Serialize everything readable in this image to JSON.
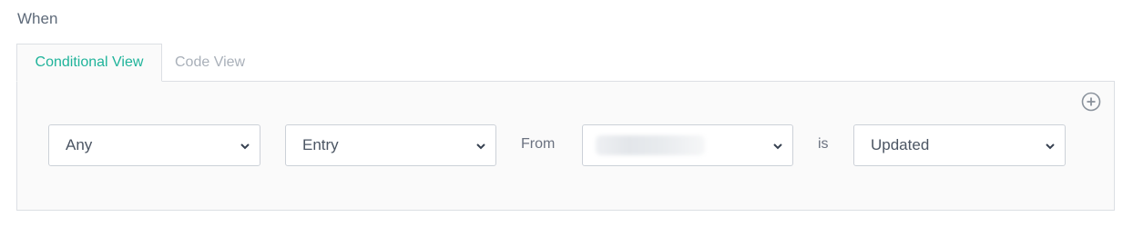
{
  "section": {
    "label": "When"
  },
  "tabs": [
    {
      "label": "Conditional View",
      "active": true
    },
    {
      "label": "Code View",
      "active": false
    }
  ],
  "condition": {
    "quantifier": {
      "value": "Any"
    },
    "entity": {
      "value": "Entry"
    },
    "from_label": "From",
    "source": {
      "value": "",
      "redacted": true
    },
    "is_label": "is",
    "event": {
      "value": "Updated"
    }
  },
  "icons": {
    "add": "plus-circle-icon",
    "dropdown": "chevron-down-icon"
  },
  "colors": {
    "accent": "#1fb39a",
    "border": "#dcdfe4",
    "panel_bg": "#fafafa",
    "text": "#4b5563",
    "muted": "#a9b0b9"
  }
}
